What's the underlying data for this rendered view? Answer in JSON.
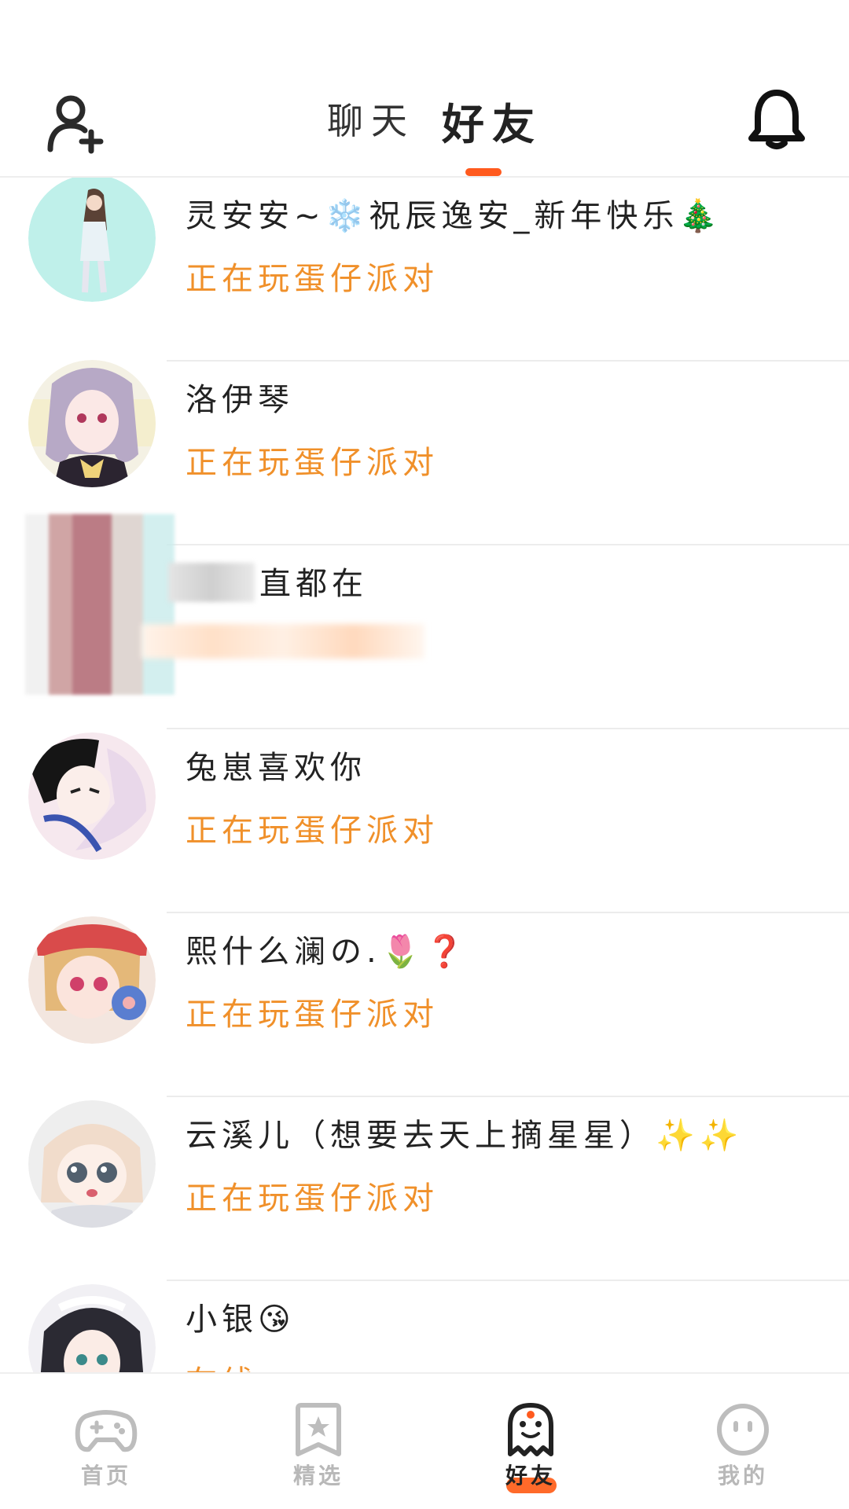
{
  "header": {
    "tabs": [
      {
        "label": "聊天",
        "active": false
      },
      {
        "label": "好友",
        "active": true
      }
    ],
    "left_icon": "add-friend-icon",
    "right_icon": "bell-icon"
  },
  "friends": [
    {
      "name": "灵安安~❄️祝辰逸安_新年快乐🎄",
      "status": "正在玩蛋仔派对"
    },
    {
      "name": "洛伊琴",
      "status": "正在玩蛋仔派对"
    },
    {
      "name": "直都在",
      "status": ""
    },
    {
      "name": "兔崽喜欢你",
      "status": "正在玩蛋仔派对"
    },
    {
      "name": "熙什么澜の.🌷❓",
      "status": "正在玩蛋仔派对"
    },
    {
      "name": "云溪儿（想要去天上摘星星）✨✨",
      "status": "正在玩蛋仔派对"
    },
    {
      "name": "小银😘",
      "status": "在线"
    }
  ],
  "bottom_nav": [
    {
      "label": "首页",
      "icon": "gamepad-icon",
      "active": false
    },
    {
      "label": "精选",
      "icon": "star-bookmark-icon",
      "active": false
    },
    {
      "label": "好友",
      "icon": "ghost-friends-icon",
      "active": true
    },
    {
      "label": "我的",
      "icon": "face-icon",
      "active": false
    }
  ],
  "colors": {
    "accent": "#ff5a1e",
    "status": "#f0902a"
  }
}
